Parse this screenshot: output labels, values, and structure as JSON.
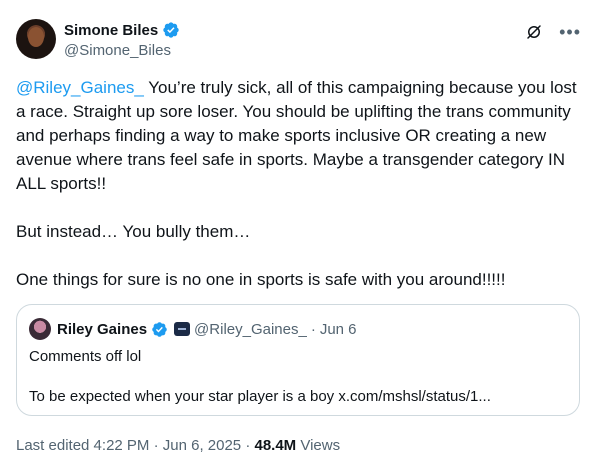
{
  "author": {
    "name": "Simone Biles",
    "handle": "@Simone_Biles"
  },
  "icons": {
    "verified": "verified-badge-icon",
    "grok": "grok-icon",
    "more": "more-icon"
  },
  "tweet": {
    "mention": "@Riley_Gaines_",
    "body_1": " You’re truly sick, all of this campaigning because you lost a race. Straight up sore loser. You should be uplifting the trans community and perhaps finding a way to make sports inclusive OR creating a new avenue where trans feel safe in sports. Maybe a transgender category IN ALL sports!!",
    "body_2": "But instead… You bully them…",
    "body_3": "One things for sure is no one in sports is safe with you around!!!!!"
  },
  "quoted": {
    "name": "Riley Gaines",
    "handle": "@Riley_Gaines_",
    "separator": "·",
    "date": "Jun 6",
    "line_1": "Comments off lol",
    "line_2": "To be expected when your star player is a boy x.com/mshsl/status/1..."
  },
  "meta": {
    "edited": "Last edited 4:22 PM · Jun 6, 2025 · ",
    "views_count": "48.4M",
    "views_label": " Views"
  },
  "colors": {
    "accent": "#1d9bf0",
    "text": "#0f1419",
    "muted": "#536471",
    "border": "#cfd9de"
  }
}
